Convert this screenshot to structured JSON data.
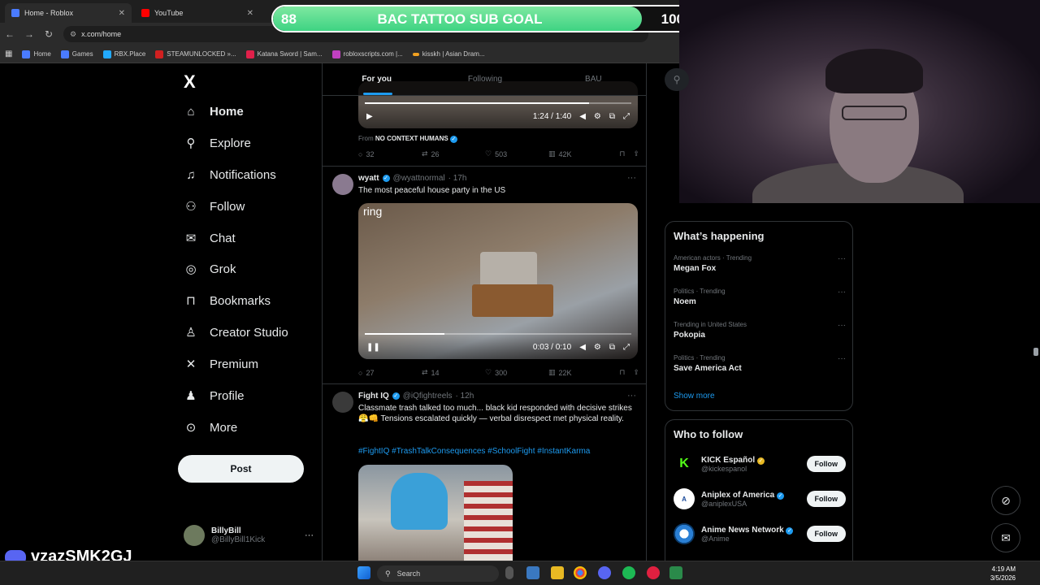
{
  "browser": {
    "tabs": [
      {
        "title": "Home - Roblox",
        "color": "#4a7bff"
      },
      {
        "title": "YouTube",
        "color": "#ff0000"
      }
    ],
    "url": "x.com/home",
    "bookmarks": [
      "Home",
      "Games",
      "RBX.Place",
      "STEAMUNLOCKED »...",
      "Katana Sword | Sam...",
      "robloxscripts.com |...",
      "kisskh | Asian Dram..."
    ]
  },
  "overlay": {
    "left_value": "88",
    "title": "BAC TATTOO SUB GOAL",
    "right_value": "100",
    "progress": 0.88,
    "discord_tag": "vzazSMK2GJ"
  },
  "sidebar": {
    "logo": "X",
    "items": [
      {
        "label": "Home",
        "icon": "home-icon"
      },
      {
        "label": "Explore",
        "icon": "search-icon"
      },
      {
        "label": "Notifications",
        "icon": "bell-icon"
      },
      {
        "label": "Follow",
        "icon": "add-user-icon"
      },
      {
        "label": "Chat",
        "icon": "mail-icon"
      },
      {
        "label": "Grok",
        "icon": "grok-icon"
      },
      {
        "label": "Bookmarks",
        "icon": "bookmark-icon"
      },
      {
        "label": "Creator Studio",
        "icon": "creator-icon"
      },
      {
        "label": "Premium",
        "icon": "x-icon"
      },
      {
        "label": "Profile",
        "icon": "person-icon"
      },
      {
        "label": "More",
        "icon": "more-icon"
      }
    ],
    "post_label": "Post",
    "user": {
      "name": "BillyBill",
      "handle": "@BillyBill1Kick"
    }
  },
  "timeline": {
    "tabs": [
      "For you",
      "Following",
      "BAU"
    ],
    "post0": {
      "video_time": "1:24 / 1:40",
      "video_progress": 0.84,
      "from_prefix": "From",
      "from_name": "NO CONTEXT HUMANS",
      "replies": "32",
      "reposts": "26",
      "likes": "503",
      "views": "42K"
    },
    "post1": {
      "name": "wyatt",
      "handle": "@wyattnormal",
      "time": "· 17h",
      "text": "The most peaceful house party in the US",
      "video_label": "ring",
      "video_time": "0:03 / 0:10",
      "video_progress": 0.3,
      "replies": "27",
      "reposts": "14",
      "likes": "300",
      "views": "22K"
    },
    "post2": {
      "name": "Fight IQ",
      "handle": "@iQfightreels",
      "time": "· 12h",
      "text": "Classmate trash talked too much... black kid responded with decisive strikes 😤👊 Tensions escalated quickly — verbal disrespect met physical reality.",
      "hashtags": "#FightIQ #TrashTalkConsequences #SchoolFight #InstantKarma"
    }
  },
  "right": {
    "happening_title": "What’s happening",
    "trends": [
      {
        "meta": "American actors · Trending",
        "name": "Megan Fox"
      },
      {
        "meta": "Politics · Trending",
        "name": "Noem"
      },
      {
        "meta": "Trending in United States",
        "name": "Pokopia"
      },
      {
        "meta": "Politics · Trending",
        "name": "Save America Act"
      }
    ],
    "show_more": "Show more",
    "who_title": "Who to follow",
    "follows": [
      {
        "name": "KICK Español",
        "handle": "@kickespanol",
        "color": "#53fc18"
      },
      {
        "name": "Aniplex of America",
        "handle": "@aniplexUSA",
        "color": "#ffffff"
      },
      {
        "name": "Anime News Network",
        "handle": "@Anime",
        "color": "#2a7fd4"
      }
    ],
    "follow_label": "Follow"
  },
  "taskbar": {
    "search_placeholder": "Search",
    "time": "4:19 AM",
    "date": "3/5/2026"
  }
}
